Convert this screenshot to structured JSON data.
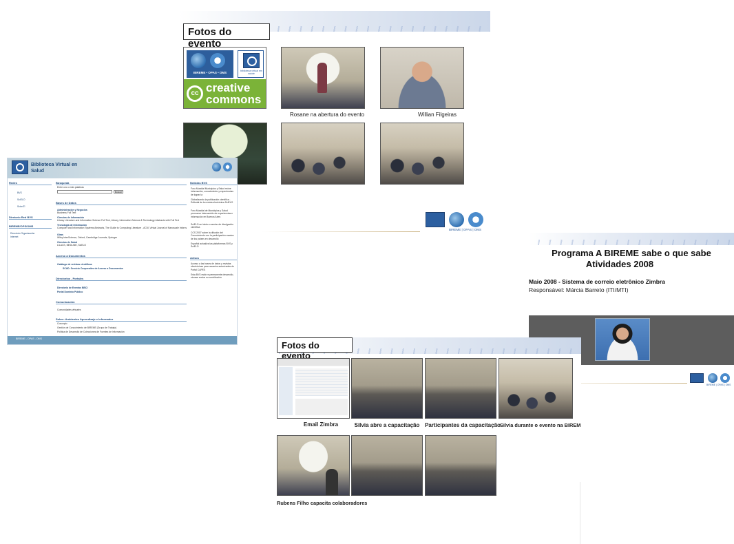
{
  "slide_top": {
    "title": "Fotos do evento",
    "logo_text_bireme": "BIREME • OPAS • OMS",
    "logo_text_bvs": "biblioteca virtual em saúde",
    "cc_text_1": "creative",
    "cc_text_2": "commons",
    "captions": [
      "Rosane na abertura do evento",
      "Willian Filgeiras"
    ],
    "footer_logo_text": "BIREME | OPAS | OMS"
  },
  "bvs_site": {
    "header_title_1": "Biblioteca Virtual en",
    "header_title_2": "Salud",
    "left_col": {
      "redes_heading": "Redes",
      "redes_items": [
        "BVS",
        "SciELO",
        "ScienTI"
      ],
      "diretorio_heading": "Diretorio Red BVS",
      "bireme_heading": "BIREME/OPS/OMS",
      "bireme_items": [
        "Directorio Organización",
        "Internet"
      ]
    },
    "mid_col": {
      "busqueda_heading": "Búsqueda",
      "busqueda_label": "Entre uno o más palabras",
      "buscar_button": "Buscar",
      "bases_heading": "Bases de Datos",
      "bases_items": [
        {
          "title": "Administración y Negocios",
          "desc": "Business Full Text"
        },
        {
          "title": "Ciencias de Información",
          "desc": "Library Literature and Information Science Full Text, Library, Information Science & Technology Abstracts with Full Text"
        },
        {
          "title": "Tecnología de Información",
          "desc": "Computer and Information Systems Abstracts, The Guide to Computing Literature - ACM, Virtual Journal of Nanoscale Information"
        },
        {
          "title": "Otras",
          "desc": "Wiley InterScience, Oxford, Cambridge Journals, Springer"
        },
        {
          "title": "Ciencias de Salud",
          "desc": "LILACS, MEDLINE, SciELO"
        }
      ],
      "acceso_heading": "Acceso a Documentos",
      "acceso_items": [
        "Catálogo de revistas científicas",
        "SCAD: Servicio Cooperativo de Acceso a Documentos"
      ],
      "directorios_heading": "Directorios , Portales",
      "directorios_items": [
        "Directorio de Eventos BBCI",
        "Portal Dominio Público"
      ],
      "comunicacion_heading": "Comunicación",
      "comunicacion_items": [
        "Comunidades virtuales"
      ],
      "sobre_heading": "Sobre: Ambientes Aprendizaje e Informador",
      "sobre_items": [
        "Concepto",
        "Gestión de Conocimiento de BIREME (Grupo de Trabajo)",
        "Política de Desarrollo de Colecciones de Fuentes de Información"
      ]
    },
    "right_col": {
      "noticias_heading": "Noticias BVS",
      "noticias_items": [
        "Foro Mundial Municipios y Salud reúne información, conocimiento y experiencias de lograr la",
        "Globalizando la publicación científica - Editorial de la revista electrónica SciELO",
        "Foro Mundial de Municipios y Salud promueve intercambio de experiencias e información en Buenos Aires",
        "SciELO se inicia a camino de divulgación científica",
        "CCS 2007 sobre la difusión del Conocimiento con la participación masiva de los países en desarrollo",
        "Español actualiza las plataformas BVS y SciELO"
      ],
      "avisos_heading": "Avisos",
      "avisos_items": [
        "Acceso a las bases de datos y revistas electrónicas para usuarios autorizados de Portal CAPES",
        "Esta BVS está en permanente desarrollo, sírvase enviar su contribución"
      ]
    },
    "footer_text": "BIREME - OPAS - OMS"
  },
  "slide_right": {
    "title_line_1": "Programa A BIREME sabe o que sabe",
    "title_line_2": "Atividades 2008",
    "subtitle": "Maio 2008 - Sistema de correio eletrônico Zimbra",
    "responsavel": "Responsável:  Márcia Barreto (ITI/MTI)",
    "footer_logo_text": "BIREME | OPAS | OMS"
  },
  "slide_bottom": {
    "title": "Fotos do evento",
    "captions": [
      "Email Zimbra",
      "Silvia abre a capacitação",
      "Participantes da capacitação",
      "Silvia durante o evento na BIREME",
      "Rubens Filho capacita colaboradores"
    ]
  }
}
